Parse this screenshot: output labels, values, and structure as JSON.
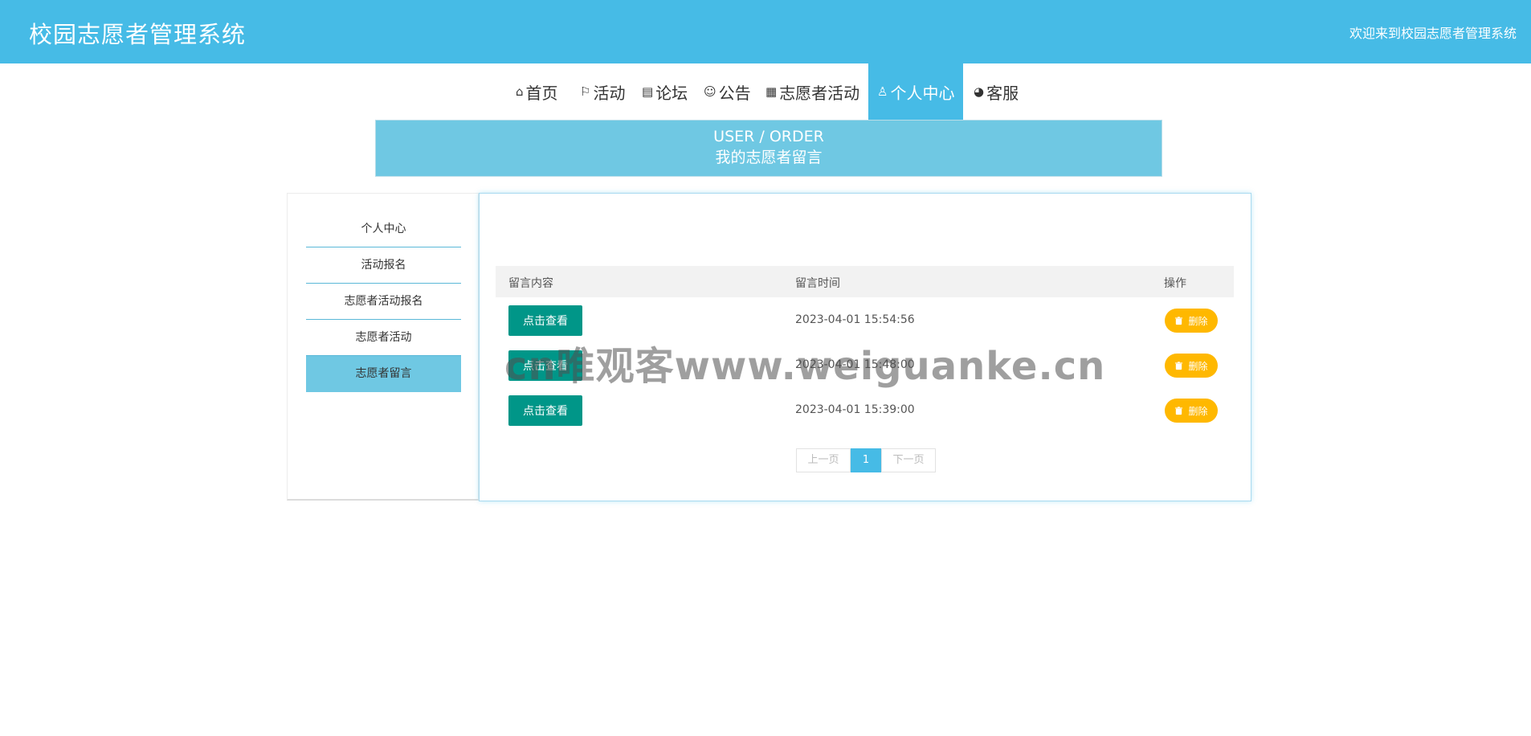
{
  "header": {
    "app_title": "校园志愿者管理系统",
    "welcome_text": "欢迎来到校园志愿者管理系统",
    "bg_color": "#46bbe6"
  },
  "nav": [
    {
      "icon": "home-icon",
      "glyph": "⌂",
      "label": "首页"
    },
    {
      "icon": "flag-icon",
      "glyph": "⚐",
      "label": "活动"
    },
    {
      "icon": "forum-icon",
      "glyph": "▤",
      "label": "论坛"
    },
    {
      "icon": "smile-icon",
      "glyph": "☺",
      "label": "公告"
    },
    {
      "icon": "gift-icon",
      "glyph": "▦",
      "label": "志愿者活动"
    },
    {
      "icon": "user-icon",
      "glyph": "♙",
      "label": "个人中心",
      "active": true
    },
    {
      "icon": "support-icon",
      "glyph": "◕",
      "label": "客服"
    }
  ],
  "banner": {
    "title_en": "USER / ORDER",
    "title_zh": "我的志愿者留言"
  },
  "sidebar": {
    "items": [
      {
        "label": "个人中心"
      },
      {
        "label": "活动报名"
      },
      {
        "label": "志愿者活动报名"
      },
      {
        "label": "志愿者活动"
      },
      {
        "label": "志愿者留言",
        "active": true
      }
    ]
  },
  "table": {
    "headers": [
      "留言内容",
      "留言时间",
      "操作"
    ],
    "rows": [
      {
        "view_label": "点击查看",
        "time": "2023-04-01 15:54:56",
        "delete_label": "删除"
      },
      {
        "view_label": "点击查看",
        "time": "2023-04-01 15:48:00",
        "delete_label": "删除"
      },
      {
        "view_label": "点击查看",
        "time": "2023-04-01 15:39:00",
        "delete_label": "删除"
      }
    ]
  },
  "pagination": {
    "prev": "上一页",
    "current": "1",
    "next": "下一页"
  },
  "watermark": "cn唯观客www.weiguanke.cn",
  "colors": {
    "accent": "#46bbe6",
    "banner": "#6fc8e3",
    "view_button": "#009688",
    "delete_button": "#ffb800"
  }
}
